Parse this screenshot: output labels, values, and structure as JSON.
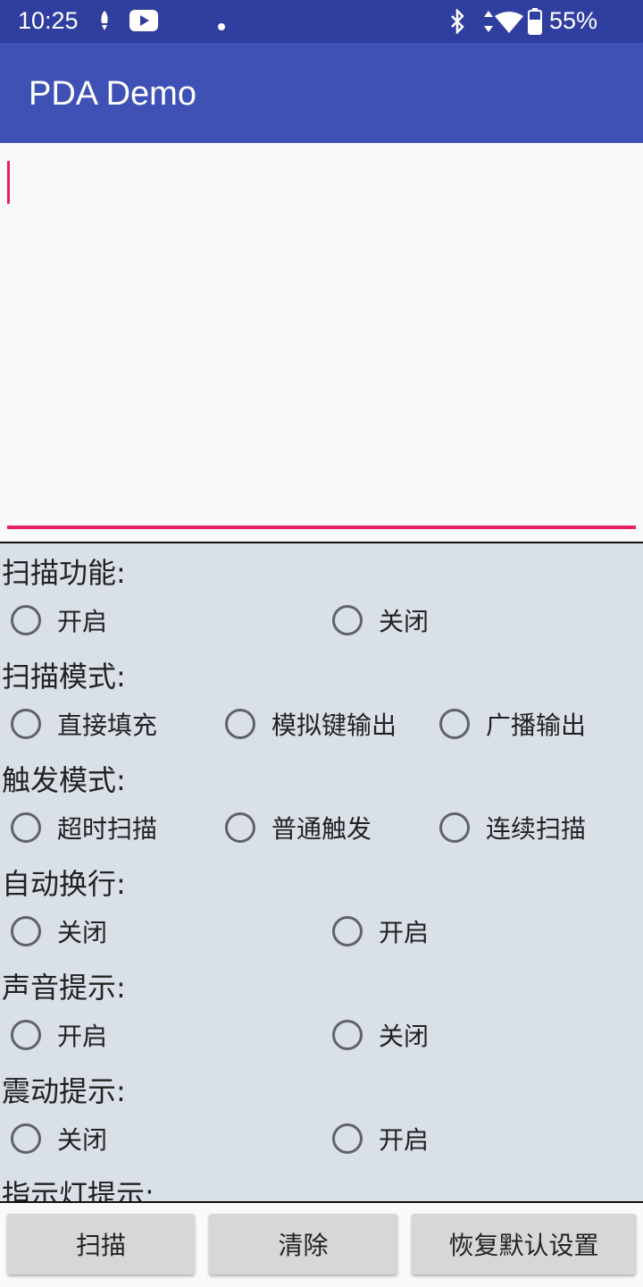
{
  "status_bar": {
    "time": "10:25",
    "battery": "55%",
    "icons": [
      "notification-rocket-icon",
      "youtube-icon",
      "dot-icon",
      "bluetooth-icon",
      "data-arrows-icon",
      "wifi-icon",
      "battery-icon"
    ]
  },
  "app": {
    "title": "PDA Demo"
  },
  "colors": {
    "status_bar": "#303f9f",
    "app_bar": "#3f51b5",
    "accent": "#e91e63",
    "settings_bg": "#d9e0e8",
    "button_bg": "#d6d7d7"
  },
  "settings": {
    "scan_function": {
      "label": "扫描功能:",
      "options": [
        "开启",
        "关闭"
      ]
    },
    "scan_mode": {
      "label": "扫描模式:",
      "options": [
        "直接填充",
        "模拟键输出",
        "广播输出"
      ]
    },
    "trigger_mode": {
      "label": "触发模式:",
      "options": [
        "超时扫描",
        "普通触发",
        "连续扫描"
      ]
    },
    "auto_newline": {
      "label": "自动换行:",
      "options": [
        "关闭",
        "开启"
      ]
    },
    "sound_prompt": {
      "label": "声音提示:",
      "options": [
        "开启",
        "关闭"
      ]
    },
    "vibrate_prompt": {
      "label": "震动提示:",
      "options": [
        "关闭",
        "开启"
      ]
    },
    "indicator_prompt": {
      "label": "指示灯提示:"
    }
  },
  "buttons": {
    "scan": "扫描",
    "clear": "清除",
    "restore": "恢复默认设置"
  }
}
